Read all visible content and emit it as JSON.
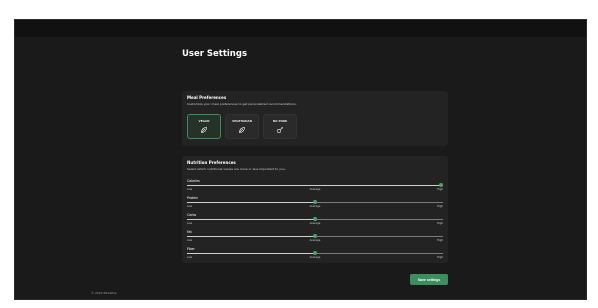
{
  "page": {
    "title": "User Settings"
  },
  "meal_preferences": {
    "title": "Meal Preferences",
    "subtitle": "Customize your meal preferences to get personalized recommendations.",
    "options": [
      {
        "label": "VEGAN",
        "icon": "leaf-icon",
        "selected": true
      },
      {
        "label": "VEGETARIAN",
        "icon": "leaf-icon",
        "selected": false
      },
      {
        "label": "NO PORK",
        "icon": "no-pork-icon",
        "selected": false
      }
    ]
  },
  "nutrition_preferences": {
    "title": "Nutrition Preferences",
    "subtitle": "Select which nutritional values are more or less important to you.",
    "scale": {
      "low": "Low",
      "average": "Average",
      "high": "High"
    },
    "items": [
      {
        "label": "Calories",
        "value": 1.0
      },
      {
        "label": "Protein",
        "value": 0.5
      },
      {
        "label": "Carbs",
        "value": 0.5
      },
      {
        "label": "Fat",
        "value": 0.5
      },
      {
        "label": "Fiber",
        "value": 0.5
      }
    ]
  },
  "actions": {
    "save_label": "Save settings"
  },
  "footer": {
    "copyright": "© 2025 BiteWise"
  },
  "colors": {
    "accent": "#3b8f5c",
    "background": "#1a1a1a",
    "card": "#232323"
  }
}
